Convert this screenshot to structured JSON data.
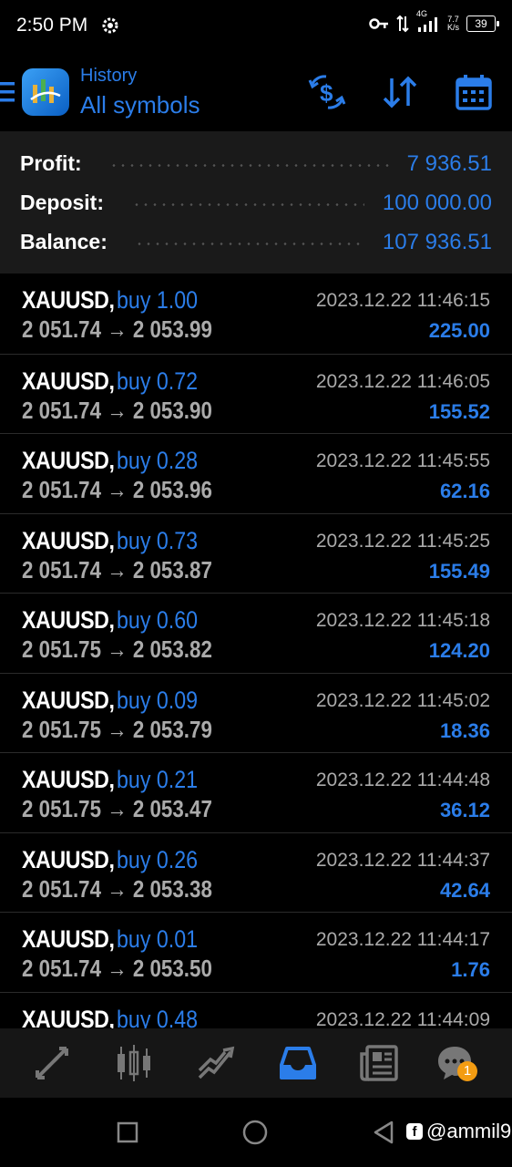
{
  "status_bar": {
    "time": "2:50 PM",
    "network": "4G",
    "speed_value": "7.7",
    "speed_unit": "K/s",
    "battery": "39"
  },
  "header": {
    "subtitle": "History",
    "title": "All symbols",
    "icons": [
      "menu-icon",
      "app-logo",
      "currency-exchange-icon",
      "sort-icon",
      "calendar-icon"
    ]
  },
  "summary": {
    "profit_label": "Profit:",
    "profit_value": "7 936.51",
    "deposit_label": "Deposit:",
    "deposit_value": "100 000.00",
    "balance_label": "Balance:",
    "balance_value": "107 936.51"
  },
  "trades": [
    {
      "symbol": "XAUUSD,",
      "type": "buy 1.00",
      "open_price": "2 051.74",
      "close_price": "2 053.99",
      "time": "2023.12.22 11:46:15",
      "profit": "225.00"
    },
    {
      "symbol": "XAUUSD,",
      "type": "buy 0.72",
      "open_price": "2 051.74",
      "close_price": "2 053.90",
      "time": "2023.12.22 11:46:05",
      "profit": "155.52"
    },
    {
      "symbol": "XAUUSD,",
      "type": "buy 0.28",
      "open_price": "2 051.74",
      "close_price": "2 053.96",
      "time": "2023.12.22 11:45:55",
      "profit": "62.16"
    },
    {
      "symbol": "XAUUSD,",
      "type": "buy 0.73",
      "open_price": "2 051.74",
      "close_price": "2 053.87",
      "time": "2023.12.22 11:45:25",
      "profit": "155.49"
    },
    {
      "symbol": "XAUUSD,",
      "type": "buy 0.60",
      "open_price": "2 051.75",
      "close_price": "2 053.82",
      "time": "2023.12.22 11:45:18",
      "profit": "124.20"
    },
    {
      "symbol": "XAUUSD,",
      "type": "buy 0.09",
      "open_price": "2 051.75",
      "close_price": "2 053.79",
      "time": "2023.12.22 11:45:02",
      "profit": "18.36"
    },
    {
      "symbol": "XAUUSD,",
      "type": "buy 0.21",
      "open_price": "2 051.75",
      "close_price": "2 053.47",
      "time": "2023.12.22 11:44:48",
      "profit": "36.12"
    },
    {
      "symbol": "XAUUSD,",
      "type": "buy 0.26",
      "open_price": "2 051.74",
      "close_price": "2 053.38",
      "time": "2023.12.22 11:44:37",
      "profit": "42.64"
    },
    {
      "symbol": "XAUUSD,",
      "type": "buy 0.01",
      "open_price": "2 051.74",
      "close_price": "2 053.50",
      "time": "2023.12.22 11:44:17",
      "profit": "1.76"
    },
    {
      "symbol": "XAUUSD,",
      "type": "buy 0.48",
      "open_price": "",
      "close_price": "",
      "time": "2023.12.22 11:44:09",
      "profit": ""
    }
  ],
  "price_arrow": "→",
  "bottom_nav": {
    "items": [
      "quotes-icon",
      "chart-icon",
      "trade-icon",
      "history-icon",
      "news-icon",
      "chat-icon"
    ],
    "active": "history-icon",
    "chat_badge": "1"
  },
  "watermark": "@ammil9",
  "colors": {
    "accent": "#2b7de9",
    "background": "#000000",
    "summary_bg": "#1a1a1a",
    "nav_bg": "#161616",
    "muted_text": "#aaaaaa",
    "badge": "#f39c12"
  }
}
